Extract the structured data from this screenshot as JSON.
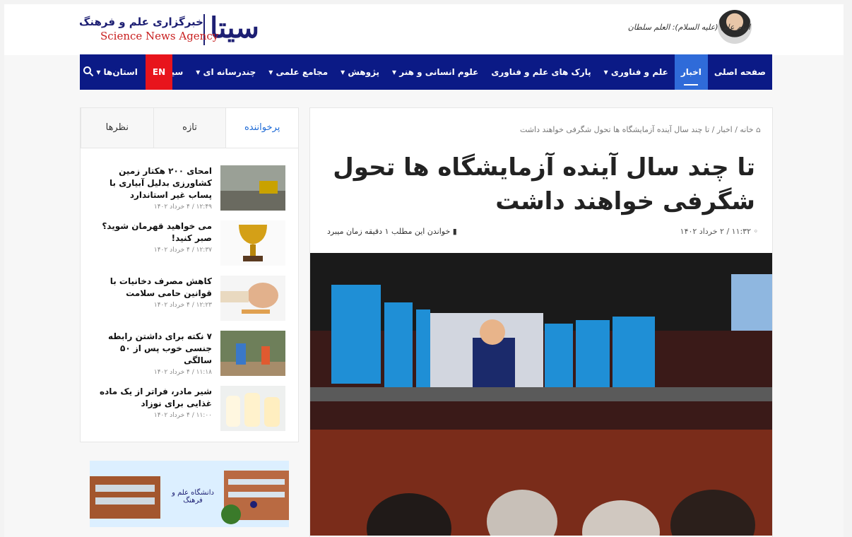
{
  "header": {
    "logo_mark": "سیتا",
    "logo_fa": "خبرگزاری علم و فرهنگ",
    "logo_en": "Science News Agency",
    "quote": "امام علی (علیه السلام): العلم سلطان"
  },
  "nav": {
    "items": [
      {
        "label": "صفحه اصلی"
      },
      {
        "label": "اخبار"
      },
      {
        "label": "علم و فناوری ▾"
      },
      {
        "label": "پارک های علم و فناوری"
      },
      {
        "label": "علوم انسانی و هنر ▾"
      },
      {
        "label": "پژوهش ▾"
      },
      {
        "label": "مجامع علمی ▾"
      },
      {
        "label": "چندرسانه ای ▾"
      },
      {
        "label": "سینا+ ▾"
      },
      {
        "label": "استان‌ها ▾"
      }
    ],
    "en_label": "EN",
    "icon": "search-icon"
  },
  "article": {
    "breadcrumb": "خانه / اخبار / تا چند سال آینده آزمایشگاه ها تحول شگرفی خواهند داشت",
    "title": "تا چند سال آینده آزمایشگاه ها تحول شگرفی خواهند داشت",
    "date": "۱۱:۳۲ / ۲ خرداد ۱۴۰۲",
    "read_time": "خواندن این مطلب ۱ دقیقه زمان میبرد"
  },
  "sidebar": {
    "tabs": [
      {
        "label": "پرخواننده"
      },
      {
        "label": "تازه"
      },
      {
        "label": "نظرها"
      }
    ],
    "posts": [
      {
        "title": "امحای ۲۰۰ هکتار زمین کشاورزی بدلیل آبیاری با پساب غیر استاندارد",
        "date": "۱۲:۴۹ / ۴ خرداد ۱۴۰۲"
      },
      {
        "title": "می خواهید قهرمان شوید؟ صبر کنید!",
        "date": "۱۲:۳۷ / ۴ خرداد ۱۴۰۲"
      },
      {
        "title": "کاهش مصرف دخانیات با قوانین حامی سلامت",
        "date": "۱۲:۲۳ / ۴ خرداد ۱۴۰۲"
      },
      {
        "title": "۷ نکته برای داشتن رابطه جنسی خوب پس از ۵۰ سالگی",
        "date": "۱۱:۱۸ / ۴ خرداد ۱۴۰۲"
      },
      {
        "title": "شیر مادر، فراتر از یک ماده غذایی برای نوزاد",
        "date": "۱۱:۰۰ / ۴ خرداد ۱۴۰۲"
      }
    ]
  },
  "banner": {
    "text": "دانشگاه علم و فرهنگ"
  }
}
